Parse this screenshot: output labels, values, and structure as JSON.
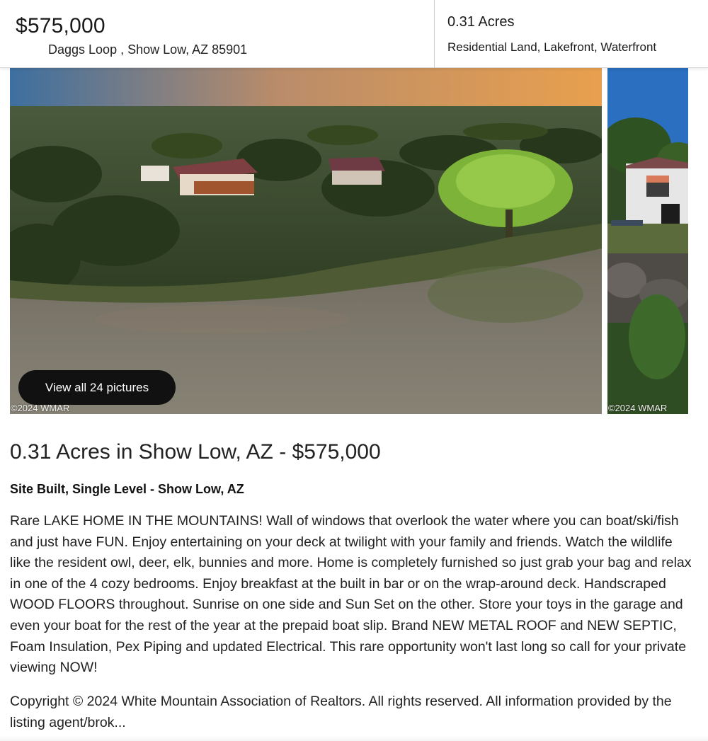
{
  "header": {
    "price": "$575,000",
    "address": "Daggs Loop , Show Low, AZ 85901",
    "acres": "0.31 Acres",
    "land_type": "Residential Land, Lakefront, Waterfront"
  },
  "gallery": {
    "view_all_label": "View all 24 pictures",
    "watermark_main": "©2024  WMAR",
    "watermark_side": "©2024  WMAR"
  },
  "listing": {
    "title": "0.31 Acres in Show Low, AZ - $575,000",
    "subtitle": "Site Built, Single Level - Show Low, AZ",
    "description": "Rare LAKE HOME IN THE MOUNTAINS! Wall of windows that overlook the water where you can boat/ski/fish and just have FUN. Enjoy entertaining on your deck at twilight with your family and friends. Watch the wildlife like the resident owl, deer, elk, bunnies and more. Home is completely furnished so just grab your bag and relax in one of the 4 cozy bedrooms. Enjoy breakfast at the built in bar or on the wrap-around deck. Handscraped WOOD FLOORS throughout. Sunrise on one side and Sun Set on the other. Store your toys in the garage and even your boat for the rest of the year at the prepaid boat slip. Brand NEW METAL ROOF and NEW SEPTIC, Foam Insulation, Pex Piping and updated Electrical. This rare opportunity won't last long so call for your private viewing NOW!",
    "copyright": "Copyright © 2024 White Mountain Association of Realtors. All rights reserved. All information provided by the listing agent/brok..."
  }
}
